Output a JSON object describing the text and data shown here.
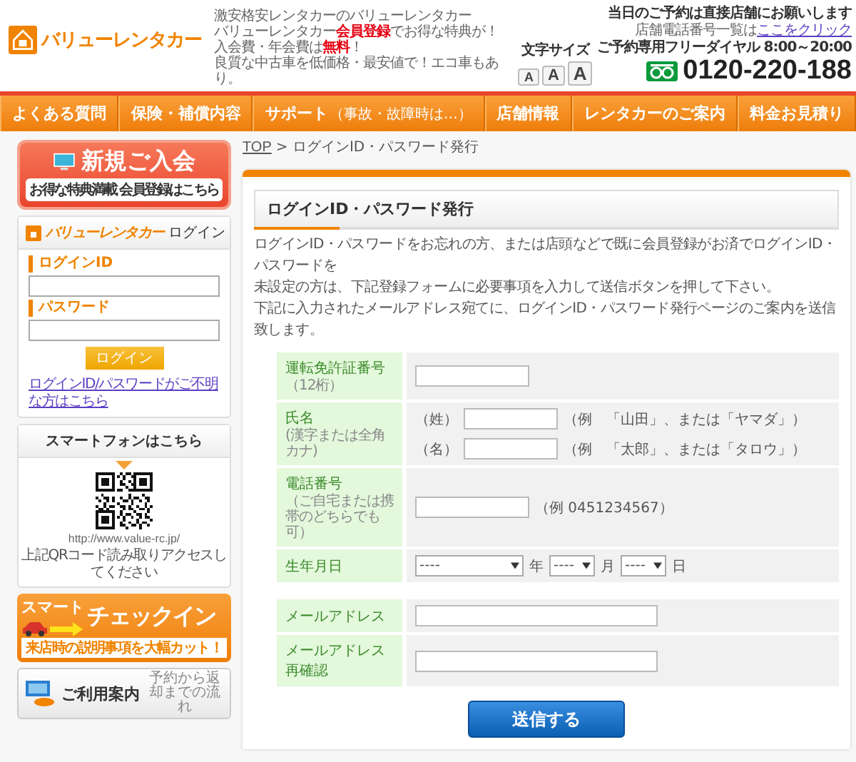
{
  "header": {
    "logo": "バリューレンタカー",
    "tagline": [
      "激安格安レンタカーのバリューレンタカー",
      "バリューレンタカー**会員登録**でお得な特典が！",
      "入会費・年会費は**無料**！",
      "良質な中古車を低価格・最安値で！エコ車もあり。"
    ],
    "text_size": {
      "label": "文字サイズ",
      "buttons": [
        "A",
        "A",
        "A"
      ]
    },
    "notice": "当日のご予約は直接店舗にお願いします",
    "store_phone": {
      "text": "店舗電話番号一覧は",
      "link": "ここをクリック"
    },
    "dial_label": "ご予約専用フリーダイヤル 8:00～20:00",
    "phone": "0120-220-188"
  },
  "nav": [
    {
      "label": "よくある質問"
    },
    {
      "label": "保険・補償内容"
    },
    {
      "label": "サポート",
      "note": "（事故・故障時は…）"
    },
    {
      "label": "店舗情報"
    },
    {
      "label": "レンタカーのご案内"
    },
    {
      "label": "料金お見積り"
    }
  ],
  "sidebar": {
    "join_banner": {
      "title": "新規ご入会",
      "sub": "お得な特典満載 会員登録はこちら"
    },
    "login": {
      "brand": "バリューレンタカー",
      "title": "ログイン",
      "id_label": "ログインID",
      "password_label": "パスワード",
      "button": "ログイン",
      "help_link": "ログインID/パスワードがご不明な方はこちら"
    },
    "smartphone": {
      "title": "スマートフォンはこちら",
      "url": "http://www.value-rc.jp/",
      "note": "上記QRコード読み取りアクセスしてください"
    },
    "checkin_banner": {
      "title_1": "スマート",
      "title_2": "チェックイン",
      "note": "来店時の説明事項を大幅カット！"
    },
    "guide_banner": {
      "title": "ご利用案内",
      "sub": "予約から返却までの流れ"
    }
  },
  "breadcrumb": {
    "link": "TOP",
    "current": "> ログインID・パスワード発行"
  },
  "form": {
    "title": "ログインID・パスワード発行",
    "paragraphs": [
      "ログインID・パスワードをお忘れの方、または店頭などで既に会員登録がお済でログインID・パスワードを",
      "未設定の方は、下記登録フォームに必要事項を入力して送信ボタンを押して下さい。",
      "下記に入力されたメールアドレス宛てに、ログインID・パスワード発行ページのご案内を送信致します。"
    ],
    "rows": [
      {
        "kind": "text",
        "label": "運転免許証番号",
        "note": "（12桁）"
      },
      {
        "kind": "name",
        "label": "氏名",
        "note": "(漢字または全角カナ)",
        "parts": [
          {
            "prefix": "（姓）",
            "example": "（例　「山田」、または「ヤマダ」）"
          },
          {
            "prefix": "（名）",
            "example": "（例　「太郎」、または「タロウ」）"
          }
        ]
      },
      {
        "kind": "text",
        "label": "電話番号",
        "note": "（ご自宅または携帯のどちらでも可）",
        "example": "（例 0451234567）"
      },
      {
        "kind": "date",
        "label": "生年月日",
        "selects": [
          {
            "value": "----",
            "unit": "年"
          },
          {
            "value": "----",
            "unit": "月"
          },
          {
            "value": "----",
            "unit": "日"
          }
        ]
      }
    ],
    "email_rows": [
      {
        "kind": "email",
        "label": "メールアドレス"
      },
      {
        "kind": "email",
        "label": "メールアドレス再確認"
      }
    ],
    "submit": "送信する"
  }
}
